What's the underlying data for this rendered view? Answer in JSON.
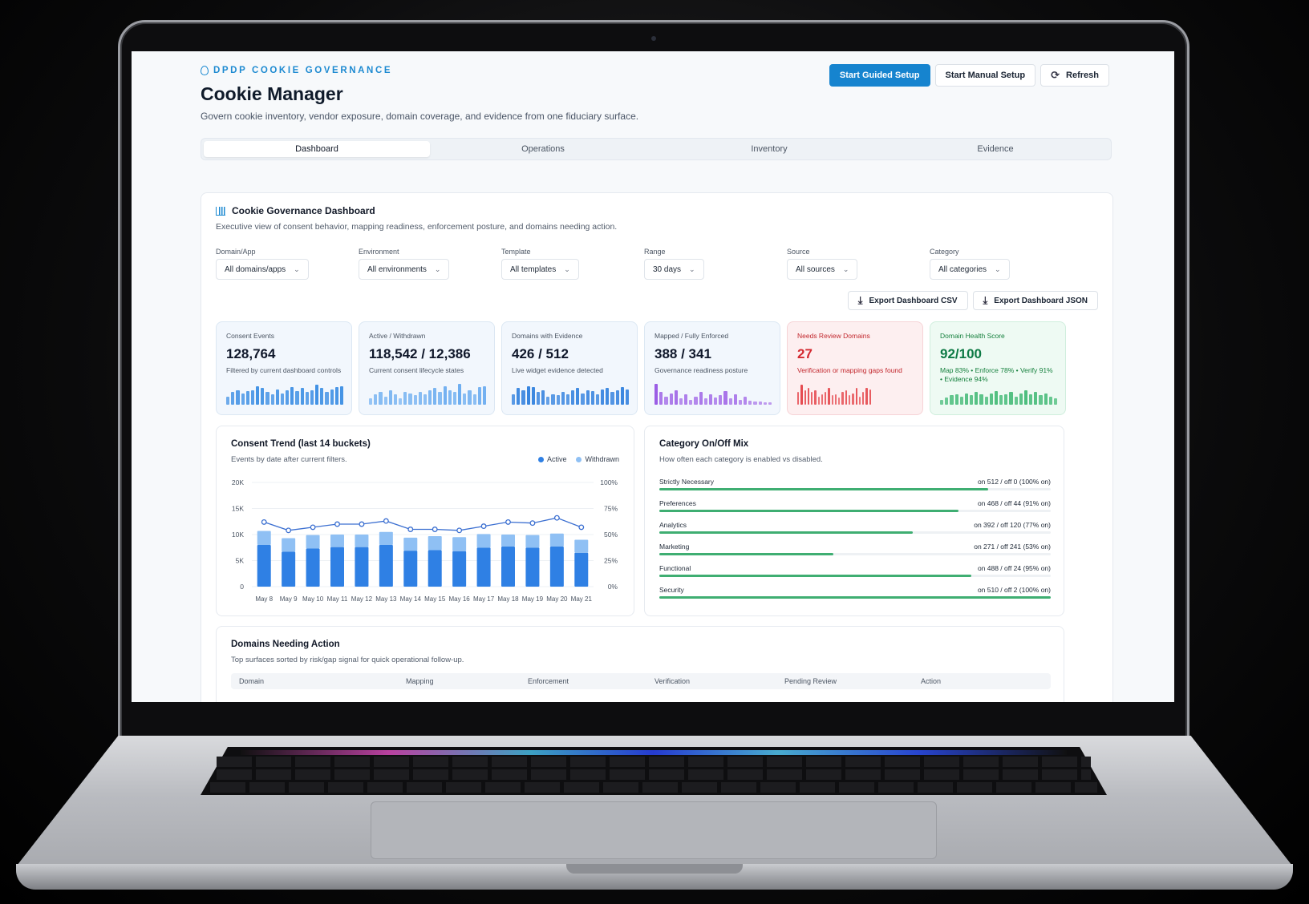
{
  "header": {
    "eyebrow": "DPDP COOKIE GOVERNANCE",
    "title": "Cookie Manager",
    "subtitle": "Govern cookie inventory, vendor exposure, domain coverage, and evidence from one fiduciary surface."
  },
  "actions": {
    "guided": "Start Guided Setup",
    "manual": "Start Manual Setup",
    "refresh": "Refresh"
  },
  "tabs": [
    {
      "label": "Dashboard",
      "active": true
    },
    {
      "label": "Operations",
      "active": false
    },
    {
      "label": "Inventory",
      "active": false
    },
    {
      "label": "Evidence",
      "active": false
    }
  ],
  "dashboard": {
    "title": "Cookie Governance Dashboard",
    "subtitle": "Executive view of consent behavior, mapping readiness, enforcement posture, and domains needing action.",
    "filters": [
      {
        "label": "Domain/App",
        "value": "All domains/apps"
      },
      {
        "label": "Environment",
        "value": "All environments"
      },
      {
        "label": "Template",
        "value": "All templates"
      },
      {
        "label": "Range",
        "value": "30 days"
      },
      {
        "label": "Source",
        "value": "All sources"
      },
      {
        "label": "Category",
        "value": "All categories"
      }
    ],
    "export_csv": "Export Dashboard CSV",
    "export_json": "Export Dashboard JSON",
    "kpis": [
      {
        "label": "Consent Events",
        "value": "128,764",
        "note": "Filtered by current dashboard controls",
        "tone": "blue",
        "bar_color": "#3d8fe4",
        "spark": [
          0.4,
          0.6,
          0.7,
          0.55,
          0.65,
          0.7,
          0.9,
          0.8,
          0.6,
          0.5,
          0.75,
          0.55,
          0.7,
          0.85,
          0.65,
          0.8,
          0.6,
          0.7,
          0.95,
          0.8,
          0.6,
          0.75,
          0.85,
          0.9
        ]
      },
      {
        "label": "Active / Withdrawn",
        "value": "118,542 / 12,386",
        "note": "Current consent lifecycle states",
        "tone": "blue",
        "bar_color": "#6eaef0",
        "spark": [
          0.3,
          0.5,
          0.6,
          0.4,
          0.7,
          0.5,
          0.3,
          0.6,
          0.55,
          0.45,
          0.6,
          0.5,
          0.7,
          0.8,
          0.6,
          0.9,
          0.7,
          0.6,
          1.0,
          0.55,
          0.7,
          0.5,
          0.85,
          0.9
        ]
      },
      {
        "label": "Domains with Evidence",
        "value": "426 / 512",
        "note": "Live widget evidence detected",
        "tone": "blue",
        "bar_color": "#2f7fde",
        "spark": [
          0.5,
          0.8,
          0.7,
          0.9,
          0.85,
          0.6,
          0.7,
          0.4,
          0.5,
          0.45,
          0.6,
          0.5,
          0.7,
          0.8,
          0.55,
          0.7,
          0.65,
          0.5,
          0.75,
          0.8,
          0.6,
          0.7,
          0.85,
          0.75
        ]
      },
      {
        "label": "Mapped / Fully Enforced",
        "value": "388 / 341",
        "note": "Governance readiness posture",
        "tone": "blue",
        "bar_color": "#9b5de5",
        "spark": [
          1.0,
          0.6,
          0.4,
          0.55,
          0.7,
          0.3,
          0.5,
          0.25,
          0.4,
          0.6,
          0.3,
          0.5,
          0.35,
          0.45,
          0.65,
          0.3,
          0.5,
          0.25,
          0.4,
          0.2,
          0.15,
          0.15,
          0.12,
          0.12
        ]
      },
      {
        "label": "Needs Review Domains",
        "value": "27",
        "note": "Verification or mapping gaps found",
        "tone": "red",
        "bar_color": "#e5484d",
        "spark": [
          0.6,
          0.95,
          0.7,
          0.8,
          0.6,
          0.7,
          0.4,
          0.5,
          0.6,
          0.8,
          0.45,
          0.5,
          0.35,
          0.6,
          0.7,
          0.45,
          0.55,
          0.8,
          0.4,
          0.6,
          0.8,
          0.75
        ]
      },
      {
        "label": "Domain Health Score",
        "value": "92/100",
        "note": "Map 83% • Enforce 78% • Verify 91% • Evidence 94%",
        "tone": "green",
        "bar_color": "#34b46b",
        "spark": [
          0.25,
          0.35,
          0.45,
          0.5,
          0.4,
          0.55,
          0.45,
          0.6,
          0.5,
          0.4,
          0.55,
          0.65,
          0.45,
          0.5,
          0.6,
          0.4,
          0.55,
          0.7,
          0.5,
          0.6,
          0.45,
          0.55,
          0.4,
          0.3
        ]
      }
    ]
  },
  "trend": {
    "title": "Consent Trend (last 14 buckets)",
    "subtitle": "Events by date after current filters.",
    "legend_active": "Active",
    "legend_withdrawn": "Withdrawn",
    "color_active": "#2f80e4",
    "color_withdrawn": "#8fc0f4",
    "color_line": "#3b6fd1"
  },
  "chart_data": {
    "type": "bar",
    "title": "Consent Trend (last 14 buckets)",
    "categories": [
      "May 8",
      "May 9",
      "May 10",
      "May 11",
      "May 12",
      "May 13",
      "May 14",
      "May 15",
      "May 16",
      "May 17",
      "May 18",
      "May 19",
      "May 20",
      "May 21"
    ],
    "series": [
      {
        "name": "Active",
        "values": [
          8000,
          6700,
          7300,
          7600,
          7600,
          8000,
          6900,
          7000,
          6800,
          7500,
          7700,
          7500,
          7700,
          6500
        ]
      },
      {
        "name": "Withdrawn",
        "values": [
          2700,
          2600,
          2600,
          2400,
          2400,
          2500,
          2500,
          2700,
          2700,
          2600,
          2300,
          2400,
          2500,
          2500
        ]
      }
    ],
    "line_pct": [
      62,
      54,
      57,
      60,
      60,
      63,
      55,
      55,
      54,
      58,
      62,
      61,
      66,
      57
    ],
    "yticks_left": [
      "20K",
      "15K",
      "10K",
      "5K",
      "0"
    ],
    "yticks_right": [
      "100%",
      "75%",
      "50%",
      "25%",
      "0%"
    ],
    "ylim": [
      0,
      20000
    ]
  },
  "mix": {
    "title": "Category On/Off Mix",
    "subtitle": "How often each category is enabled vs disabled.",
    "rows": [
      {
        "name": "Strictly Necessary",
        "on": "512",
        "off": "0",
        "pct": 100,
        "value": "on 512 / off 0 (100% on)"
      },
      {
        "name": "Preferences",
        "on": "468",
        "off": "44",
        "pct": 91,
        "value": "on 468 / off 44 (91% on)"
      },
      {
        "name": "Analytics",
        "on": "392",
        "off": "120",
        "pct": 77,
        "value": "on 392 / off 120 (77% on)"
      },
      {
        "name": "Marketing",
        "on": "271",
        "off": "241",
        "pct": 53,
        "value": "on 271 / off 241 (53% on)"
      },
      {
        "name": "Functional",
        "on": "488",
        "off": "24",
        "pct": 95,
        "value": "on 488 / off 24 (95% on)"
      },
      {
        "name": "Security",
        "on": "510",
        "off": "2",
        "pct": 100,
        "value": "on 510 / off 2 (100% on)"
      }
    ]
  },
  "domains": {
    "title": "Domains Needing Action",
    "subtitle": "Top surfaces sorted by risk/gap signal for quick operational follow-up.",
    "columns": [
      "Domain",
      "Mapping",
      "Enforcement",
      "Verification",
      "Pending Review",
      "Action"
    ]
  }
}
